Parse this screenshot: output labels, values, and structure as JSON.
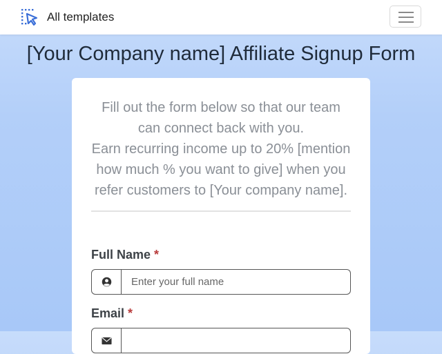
{
  "navbar": {
    "brand_text": "All templates",
    "brand_icon": "pointer-select-icon",
    "menu_icon": "hamburger-menu-icon"
  },
  "page": {
    "title": "[Your Company name] Affiliate Signup Form"
  },
  "form": {
    "intro_line1": "Fill out the form below so that our team can connect back with you.",
    "intro_line2": "Earn recurring income up to 20% [mention how much % you want to give] when you refer customers to [Your company name].",
    "fields": [
      {
        "label": "Full Name",
        "required_mark": "*",
        "placeholder": "Enter your full name",
        "icon": "user-circle-icon"
      },
      {
        "label": "Email",
        "required_mark": "*",
        "placeholder": "",
        "icon": "envelope-icon"
      }
    ]
  },
  "colors": {
    "accent": "#3b6fd8",
    "required": "#b83b3b",
    "background": "#b3cff9"
  }
}
